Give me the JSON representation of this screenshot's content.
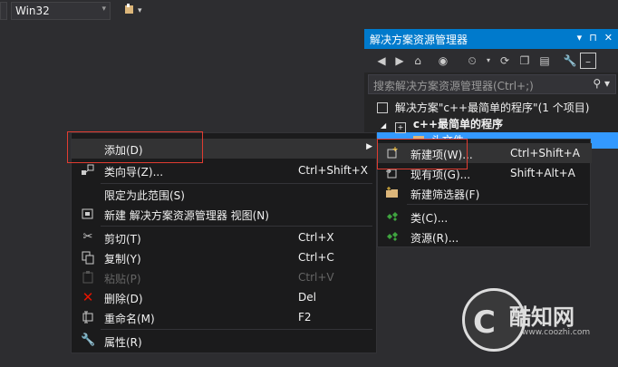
{
  "toolbar": {
    "platform": "Win32"
  },
  "solution_explorer": {
    "title": "解决方案资源管理器",
    "title_buttons": [
      "▾",
      "⊓",
      "✕"
    ],
    "search_placeholder": "搜索解决方案资源管理器(Ctrl+;)",
    "tree": {
      "solution": "解决方案\"c++最简单的程序\"(1 个项目)",
      "project": "c++最简单的程序",
      "selected": "头文件"
    }
  },
  "context_menu": {
    "items": [
      {
        "label": "添加(D)",
        "shortcut": "",
        "icon": "",
        "submenu": true
      },
      {
        "label": "类向导(Z)...",
        "shortcut": "Ctrl+Shift+X",
        "icon": "class-wizard-icon"
      },
      {
        "label": "限定为此范围(S)",
        "shortcut": "",
        "icon": ""
      },
      {
        "label": "新建 解决方案资源管理器 视图(N)",
        "shortcut": "",
        "icon": "new-view-icon"
      },
      {
        "label": "剪切(T)",
        "shortcut": "Ctrl+X",
        "icon": "cut-icon"
      },
      {
        "label": "复制(Y)",
        "shortcut": "Ctrl+C",
        "icon": "copy-icon"
      },
      {
        "label": "粘贴(P)",
        "shortcut": "Ctrl+V",
        "icon": "paste-icon",
        "disabled": true
      },
      {
        "label": "删除(D)",
        "shortcut": "Del",
        "icon": "delete-icon"
      },
      {
        "label": "重命名(M)",
        "shortcut": "F2",
        "icon": "rename-icon"
      },
      {
        "label": "属性(R)",
        "shortcut": "",
        "icon": "properties-icon"
      }
    ]
  },
  "submenu": {
    "items": [
      {
        "label": "新建项(W)...",
        "shortcut": "Ctrl+Shift+A",
        "icon": "new-item-icon"
      },
      {
        "label": "现有项(G)...",
        "shortcut": "Shift+Alt+A",
        "icon": "existing-item-icon"
      },
      {
        "label": "新建筛选器(F)",
        "shortcut": "",
        "icon": "new-filter-icon"
      },
      {
        "label": "类(C)...",
        "shortcut": "",
        "icon": "class-icon"
      },
      {
        "label": "资源(R)...",
        "shortcut": "",
        "icon": "resource-icon"
      }
    ]
  },
  "watermark": {
    "brand": "酷知网",
    "url": "www.coozhi.com"
  },
  "colors": {
    "accent": "#007acc",
    "selection": "#3399ff",
    "highlight_border": "#e03c31",
    "menu_bg": "#1b1b1c",
    "delete_red": "#e51400"
  }
}
